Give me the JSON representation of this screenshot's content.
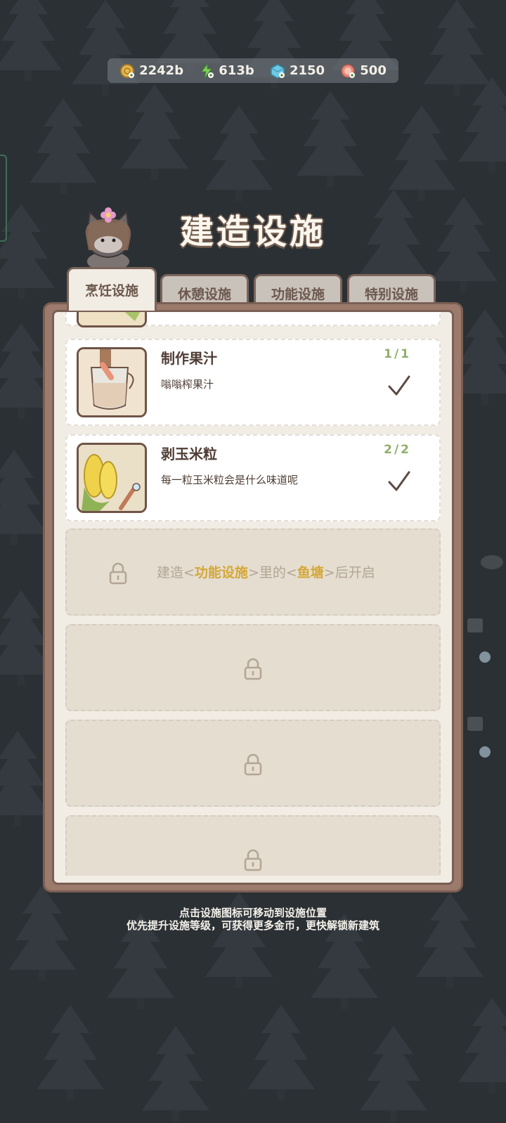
{
  "currencies": [
    {
      "icon": "gold-coin-icon",
      "value": "2242b",
      "color": "#e7b84a"
    },
    {
      "icon": "lightning-icon",
      "value": "613b",
      "color": "#7fcf5a"
    },
    {
      "icon": "ice-cube-icon",
      "value": "2150",
      "color": "#6ec9e6"
    },
    {
      "icon": "cookie-icon",
      "value": "500",
      "color": "#e58a7a"
    }
  ],
  "title": "建造设施",
  "tabs": [
    {
      "label": "烹饪设施",
      "active": true
    },
    {
      "label": "休憩设施",
      "active": false
    },
    {
      "label": "功能设施",
      "active": false
    },
    {
      "label": "特别设施",
      "active": false
    }
  ],
  "facilities": [
    {
      "name": "制作果汁",
      "desc": "嗡嗡榨果汁",
      "count": "1/1",
      "icon": "juice-cup-icon"
    },
    {
      "name": "剥玉米粒",
      "desc": "每一粒玉米粒会是什么味道呢",
      "count": "2/2",
      "icon": "corn-icon"
    }
  ],
  "locked_hint": {
    "prefix": "建造<",
    "category": "功能设施",
    "middle": ">里的<",
    "building": "鱼塘",
    "suffix": ">后开启"
  },
  "hints": [
    "点击设施图标可移动到设施位置",
    "优先提升设施等级，可获得更多金币，更快解锁新建筑"
  ],
  "colors": {
    "accent_text": "#d4a736",
    "count_text": "#8fae6a",
    "panel_frame": "#9c7b6c"
  }
}
